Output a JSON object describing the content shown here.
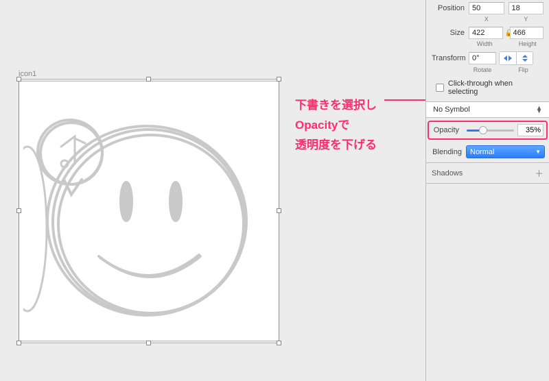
{
  "artboard": {
    "label": "icon1"
  },
  "annotation": {
    "line1": "下書きを選択し",
    "line2": "Opacityで",
    "line3": "透明度を下げる"
  },
  "inspector": {
    "position": {
      "label": "Position",
      "x": "50",
      "y": "18",
      "xLabel": "X",
      "yLabel": "Y"
    },
    "size": {
      "label": "Size",
      "w": "422",
      "h": "466",
      "wLabel": "Width",
      "hLabel": "Height"
    },
    "transform": {
      "label": "Transform",
      "rotate": "0°",
      "rotateLabel": "Rotate",
      "flipLabel": "Flip"
    },
    "clickThrough": {
      "label": "Click-through when selecting",
      "checked": false
    },
    "symbol": {
      "value": "No Symbol"
    },
    "opacity": {
      "label": "Opacity",
      "value": "35%",
      "percent": 35
    },
    "blending": {
      "label": "Blending",
      "value": "Normal"
    },
    "shadows": {
      "label": "Shadows"
    }
  }
}
